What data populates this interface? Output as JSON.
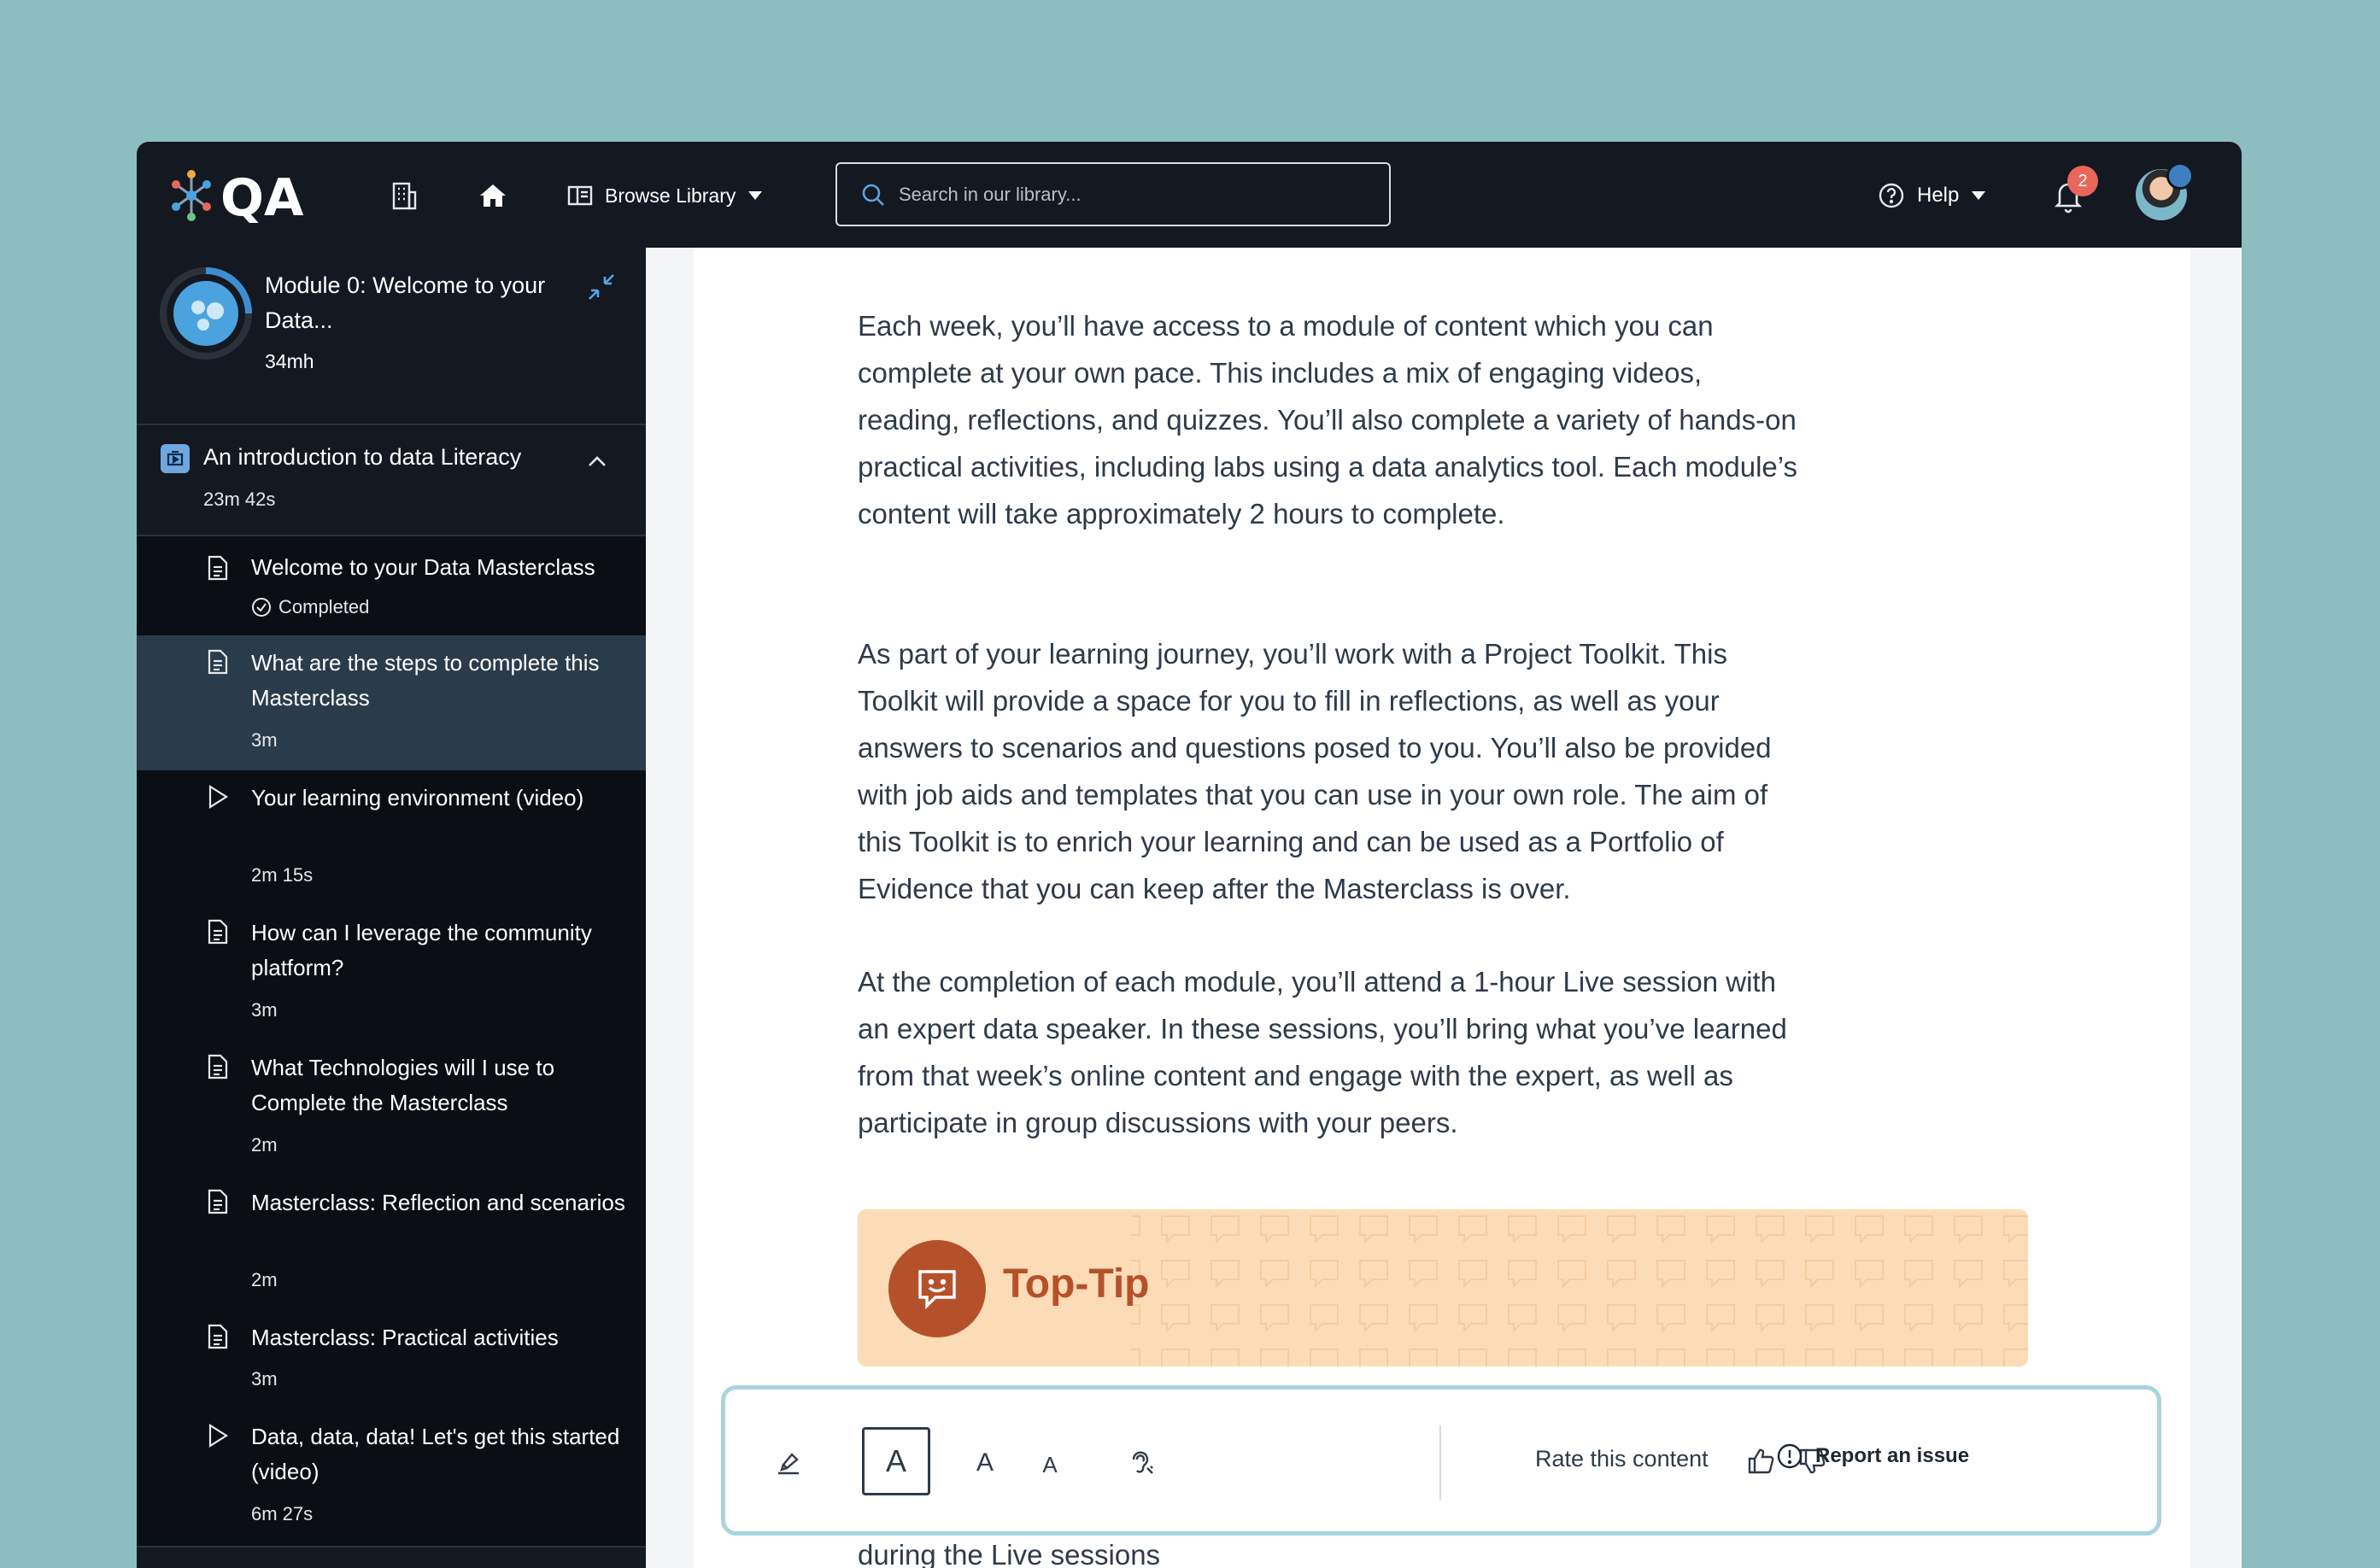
{
  "header": {
    "logo_text": "QA",
    "browse_label": "Browse Library",
    "search_placeholder": "Search in our library...",
    "help_label": "Help",
    "notification_count": "2"
  },
  "module": {
    "title": "Module 0: Welcome to your Data...",
    "duration": "34mh"
  },
  "section": {
    "title": "An introduction to data Literacy",
    "duration": "23m 42s"
  },
  "items": [
    {
      "title": "Welcome to your Data Masterclass",
      "meta": "Completed",
      "icon": "document-icon",
      "completed": true
    },
    {
      "title": "What are the steps to complete this Masterclass",
      "meta": "3m",
      "icon": "document-icon",
      "active": true
    },
    {
      "title": "Your learning environment (video)",
      "meta": "2m 15s",
      "icon": "play-icon"
    },
    {
      "title": "How can I leverage the community platform?",
      "meta": "3m",
      "icon": "document-icon"
    },
    {
      "title": "What Technologies will I use to Complete the Masterclass",
      "meta": "2m",
      "icon": "document-icon"
    },
    {
      "title": "Masterclass: Reflection and scenarios",
      "meta": "2m",
      "icon": "document-icon"
    },
    {
      "title": "Masterclass: Practical activities",
      "meta": "3m",
      "icon": "document-icon"
    },
    {
      "title": "Data, data, data! Let's get this started (video)",
      "meta": "6m 27s",
      "icon": "play-icon"
    }
  ],
  "content": {
    "paragraphs": [
      "Each week, you’ll have access to a module of content which you can complete at your own pace. This includes a mix of engaging videos, reading, reflections, and quizzes. You’ll also complete a variety of hands-on practical activities, including labs using a data analytics tool. Each module’s content will take approximately 2 hours to complete.",
      "As part of your learning journey, you’ll work with a Project Toolkit. This Toolkit will provide a space for you to fill in reflections, as well as your answers to scenarios and questions posed to you. You’ll also be provided with job aids and templates that you can use in your own role. The aim of this Toolkit is to enrich your learning and can be used as a Portfolio of Evidence that you can keep after the Masterclass is over.",
      "At the completion of each module, you’ll attend a 1-hour Live session with an expert data speaker. In these sessions, you’ll bring what you’ve learned from that week’s online content and engage with the expert, as well as participate in group discussions with your peers."
    ],
    "tip_title": "Top-Tip",
    "cutoff_text": "during the Live sessions"
  },
  "toolbar": {
    "font_large": "A",
    "font_medium": "A",
    "font_small": "A",
    "rate_label": "Rate this content",
    "report_label": "Report an issue"
  },
  "colors": {
    "page_bg": "#8bbdc1",
    "topbar_bg": "#141821",
    "sidebar_bg": "#0b0e14",
    "active_item_bg": "#2a3b4b",
    "tip_bg": "#fcdcb6",
    "tip_accent": "#b5512a",
    "toolbar_border": "#a9d4e0",
    "badge": "#e8665a"
  }
}
